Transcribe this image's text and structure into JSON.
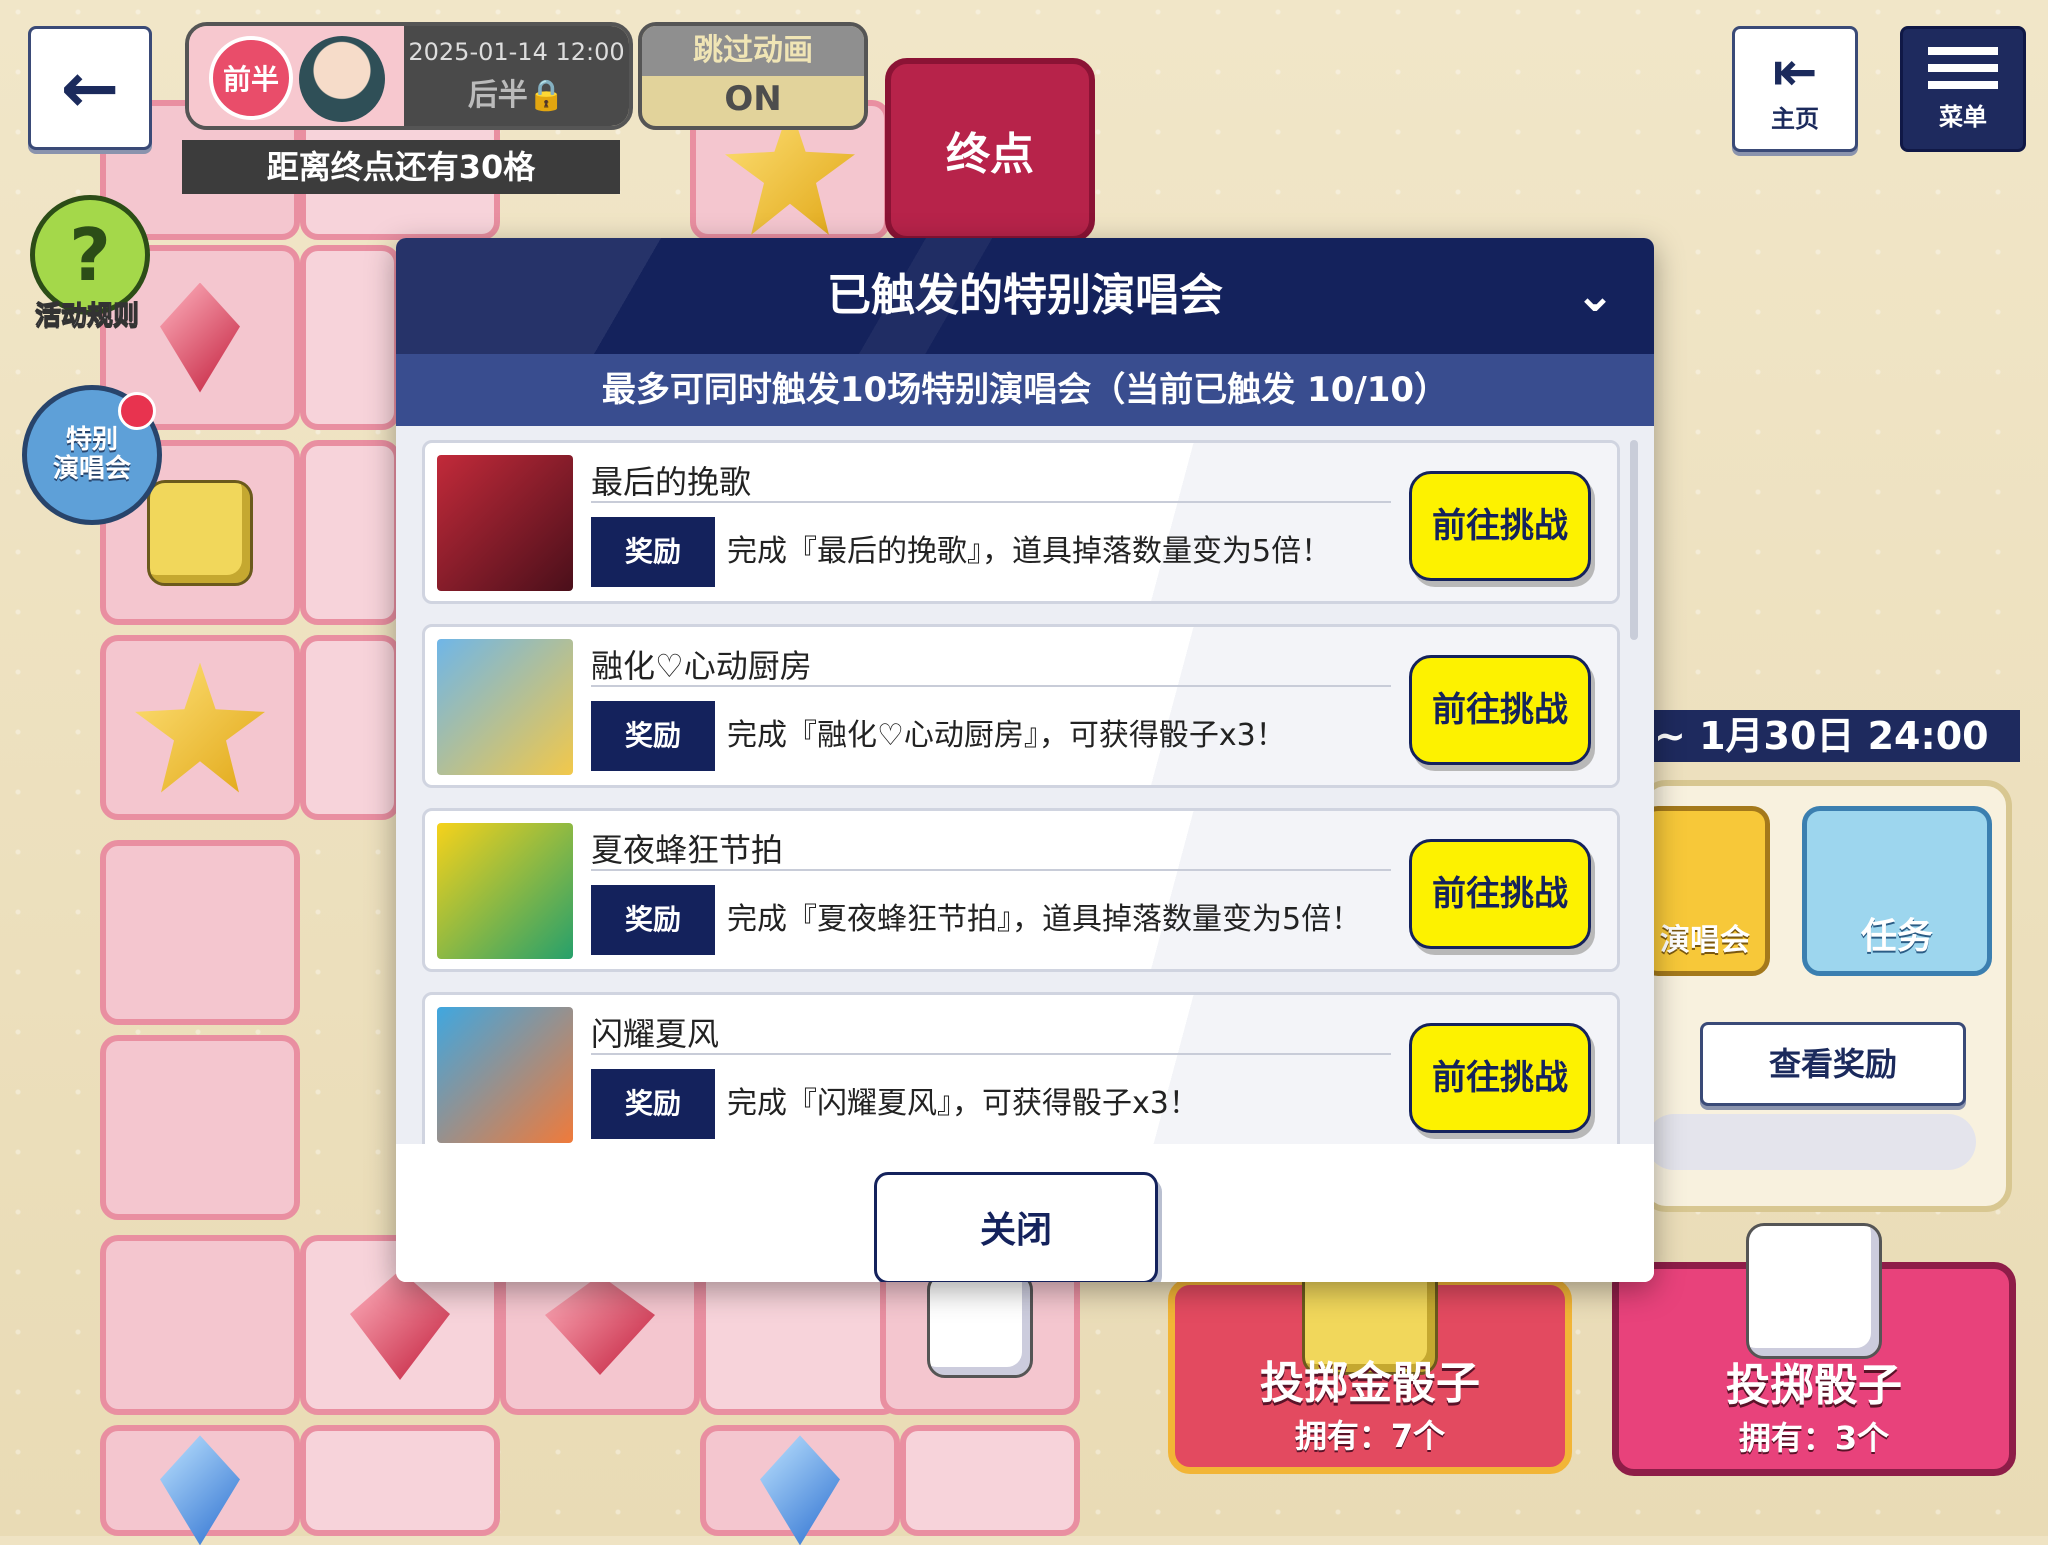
{
  "hud": {
    "back_icon": "arrow-left-icon",
    "phase_first": "前半",
    "phase_date": "2025-01-14 12:00",
    "phase_second": "后半🔒",
    "skip_title": "跳过动画",
    "skip_value": "ON",
    "distance": "距离终点还有30格",
    "goal": "终点",
    "rules": "活动规则",
    "special_concert": "特别\n演唱会",
    "home": "主页",
    "menu": "菜单"
  },
  "side": {
    "date_range": "~ 1月30日 24:00",
    "concert_card": "演唱会",
    "mission_card": "任务",
    "view_rewards": "查看奖励"
  },
  "roll": {
    "gold_title": "投掷金骰子",
    "gold_count": "拥有：7个",
    "normal_title": "投掷骰子",
    "normal_count": "拥有：3个"
  },
  "modal": {
    "title": "已触发的特别演唱会",
    "subtitle": "最多可同时触发10场特别演唱会（当前已触发 10/10）",
    "reward_label": "奖励",
    "go_label": "前往挑战",
    "close": "关闭",
    "items": [
      {
        "name": "最后的挽歌",
        "desc": "完成『最后的挽歌』，道具掉落数量变为5倍！",
        "thumb_colors": [
          "#c22a3a",
          "#4a0f1a"
        ]
      },
      {
        "name": "融化♡心动厨房",
        "desc": "完成『融化♡心动厨房』，可获得骰子x3！",
        "thumb_colors": [
          "#6fb6e8",
          "#f2c84a"
        ]
      },
      {
        "name": "夏夜蜂狂节拍",
        "desc": "完成『夏夜蜂狂节拍』，道具掉落数量变为5倍！",
        "thumb_colors": [
          "#f6d21b",
          "#26a06b"
        ]
      },
      {
        "name": "闪耀夏风",
        "desc": "完成『闪耀夏风』，可获得骰子x3！",
        "thumb_colors": [
          "#3fa7e0",
          "#f07a3a"
        ]
      }
    ]
  },
  "colors": {
    "navy": "#14225c",
    "sub_header": "#394d8f",
    "go_button": "#fdf200",
    "board_cell": "#f4c6cf"
  }
}
